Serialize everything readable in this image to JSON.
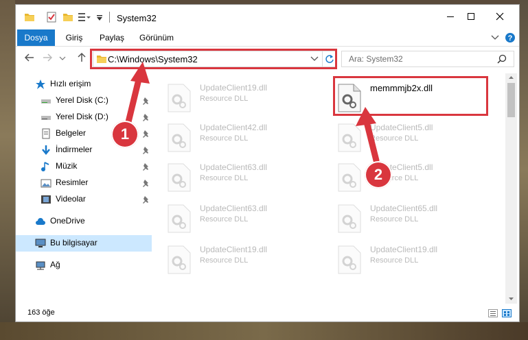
{
  "window": {
    "title": "System32"
  },
  "ribbon": {
    "tabs": [
      "Dosya",
      "Giriş",
      "Paylaş",
      "Görünüm"
    ],
    "active_tab": 0
  },
  "navigation": {
    "address": "C:\\Windows\\System32",
    "search_placeholder": "Ara: System32"
  },
  "sidebar": {
    "items": [
      {
        "label": "Hızlı erişim",
        "icon": "star-icon"
      },
      {
        "label": "Yerel Disk (C:)",
        "icon": "drive-icon",
        "pinned": true
      },
      {
        "label": "Yerel Disk (D:)",
        "icon": "drive-icon",
        "pinned": true
      },
      {
        "label": "Belgeler",
        "icon": "documents-icon",
        "pinned": true
      },
      {
        "label": "İndirmeler",
        "icon": "download-icon",
        "pinned": true
      },
      {
        "label": "Müzik",
        "icon": "music-icon",
        "pinned": true
      },
      {
        "label": "Resimler",
        "icon": "pictures-icon",
        "pinned": true
      },
      {
        "label": "Videolar",
        "icon": "videos-icon",
        "pinned": true
      },
      {
        "label": "OneDrive",
        "icon": "cloud-icon"
      },
      {
        "label": "Bu bilgisayar",
        "icon": "computer-icon",
        "selected": true
      },
      {
        "label": "Ağ",
        "icon": "network-icon"
      }
    ]
  },
  "files": [
    {
      "name": "UpdateClient19.dll",
      "type": "Resource DLL",
      "faded": true
    },
    {
      "name": "memmmjb2x.dll",
      "type": "",
      "faded": false
    },
    {
      "name": "UpdateClient42.dll",
      "type": "Resource DLL",
      "faded": true
    },
    {
      "name": "UpdateClient5.dll",
      "type": "Resource DLL",
      "faded": true
    },
    {
      "name": "UpdateClient63.dll",
      "type": "Resource DLL",
      "faded": true
    },
    {
      "name": "UpdateClient5.dll",
      "type": "Resource DLL",
      "faded": true
    },
    {
      "name": "UpdateClient63.dll",
      "type": "Resource DLL",
      "faded": true
    },
    {
      "name": "UpdateClient65.dll",
      "type": "Resource DLL",
      "faded": true
    },
    {
      "name": "UpdateClient19.dll",
      "type": "Resource DLL",
      "faded": true
    },
    {
      "name": "UpdateClient19.dll",
      "type": "Resource DLL",
      "faded": true
    }
  ],
  "status": {
    "item_count": "163 öğe"
  },
  "annotations": {
    "step1": "1",
    "step2": "2"
  },
  "colors": {
    "accent": "#1979ca",
    "highlight_red": "#d9363e",
    "selection": "#cce8ff"
  }
}
